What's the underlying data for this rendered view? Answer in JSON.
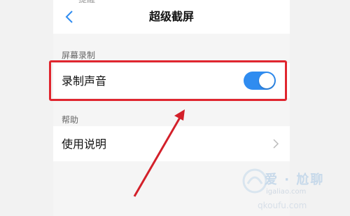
{
  "header": {
    "title": "超级截屏",
    "status_fragment": "提醒"
  },
  "sections": [
    {
      "label": "屏幕录制",
      "rows": [
        {
          "label": "录制声音",
          "toggle_on": true
        }
      ]
    },
    {
      "label": "帮助",
      "rows": [
        {
          "label": "使用说明"
        }
      ]
    }
  ],
  "watermark": {
    "brand": "爱 · 尬聊",
    "url1": "igaliao.com",
    "url2": "qkoufu.com"
  },
  "colors": {
    "accent": "#2f8cf0",
    "annotation": "#e0262f",
    "background": "#f2f2f2"
  }
}
